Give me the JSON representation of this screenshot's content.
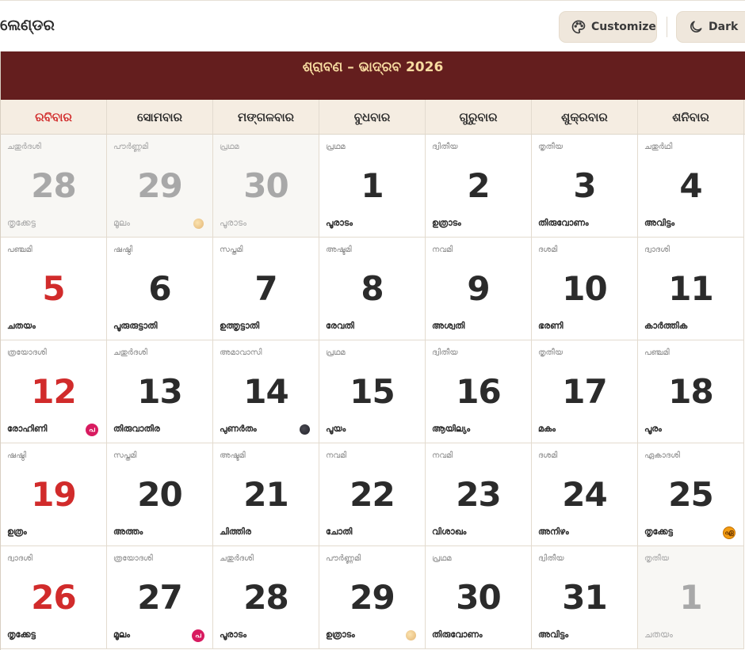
{
  "header": {
    "title": "ଲେଣ୍ଡର",
    "customize_label": "Customize",
    "dark_label": "Dark"
  },
  "banner": {
    "title": "ଶ୍ରାବଣ – ଭାଦ୍ରବ 2026"
  },
  "colors": {
    "banner_bg": "#641e1e",
    "banner_text": "#f7dba0",
    "sunday_red": "#d12b2b",
    "weekday_bg": "#f5ede2",
    "festival_pink": "#d81b60",
    "festival_orange": "#f39c12"
  },
  "weekdays": [
    "ରବିବାର",
    "ସୋମବାର",
    "ମଙ୍ଗଳବାର",
    "ବୁଧବାର",
    "ଗୁରୁବାର",
    "ଶୁକ୍ରବାର",
    "ଶନିବାର"
  ],
  "weeks": [
    [
      {
        "day": "28",
        "tithi": "ചതുർദശി",
        "star": "തൃക്കേട്ട",
        "muted": true
      },
      {
        "day": "29",
        "tithi": "പൗർണ്ണമി",
        "star": "മൂലം",
        "muted": true,
        "moon": "full"
      },
      {
        "day": "30",
        "tithi": "പ്രഥമ",
        "star": "പൂരാടം",
        "muted": true
      },
      {
        "day": "1",
        "tithi": "പ്രഥമ",
        "star": "പൂരാടം"
      },
      {
        "day": "2",
        "tithi": "ദ്വിതീയ",
        "star": "ഉത്രാടം"
      },
      {
        "day": "3",
        "tithi": "തൃതീയ",
        "star": "തിരുവോണം"
      },
      {
        "day": "4",
        "tithi": "ചതുർഥി",
        "star": "അവിട്ടം"
      }
    ],
    [
      {
        "day": "5",
        "tithi": "പഞ്ചമി",
        "star": "ചതയം"
      },
      {
        "day": "6",
        "tithi": "ഷഷ്ഠി",
        "star": "പൂരുരുട്ടാതി"
      },
      {
        "day": "7",
        "tithi": "സപ്തമി",
        "star": "ഉത്തൃട്ടാതി"
      },
      {
        "day": "8",
        "tithi": "അഷ്ടമി",
        "star": "രേവതി"
      },
      {
        "day": "9",
        "tithi": "നവമി",
        "star": "അശ്വതി"
      },
      {
        "day": "10",
        "tithi": "ദശമി",
        "star": "ഭരണി"
      },
      {
        "day": "11",
        "tithi": "ദ്വാദശി",
        "star": "കാർത്തിക"
      }
    ],
    [
      {
        "day": "12",
        "tithi": "ത്രയോദശി",
        "star": "രോഹിണി",
        "badge": "pink",
        "badge_text": "പ"
      },
      {
        "day": "13",
        "tithi": "ചതുർദശി",
        "star": "തിരുവാതിര"
      },
      {
        "day": "14",
        "tithi": "അമാവാസി",
        "star": "പുണർതം",
        "moon": "new"
      },
      {
        "day": "15",
        "tithi": "പ്രഥമ",
        "star": "പൂയം"
      },
      {
        "day": "16",
        "tithi": "ദ്വിതീയ",
        "star": "ആയില്യം"
      },
      {
        "day": "17",
        "tithi": "തൃതീയ",
        "star": "മകം"
      },
      {
        "day": "18",
        "tithi": "പഞ്ചമി",
        "star": "പൂരം"
      }
    ],
    [
      {
        "day": "19",
        "tithi": "ഷഷ്ഠി",
        "star": "ഉത്രം"
      },
      {
        "day": "20",
        "tithi": "സപ്തമി",
        "star": "അത്തം"
      },
      {
        "day": "21",
        "tithi": "അഷ്ടമി",
        "star": "ചിത്തിര"
      },
      {
        "day": "22",
        "tithi": "നവമി",
        "star": "ചോതി"
      },
      {
        "day": "23",
        "tithi": "നവമി",
        "star": "വിശാഖം"
      },
      {
        "day": "24",
        "tithi": "ദശമി",
        "star": "അനിഴം"
      },
      {
        "day": "25",
        "tithi": "ഏകാദശി",
        "star": "തൃക്കേട്ട",
        "badge": "orange",
        "badge_text": "ഏ"
      }
    ],
    [
      {
        "day": "26",
        "tithi": "ദ്വാദശി",
        "star": "തൃക്കേട്ട"
      },
      {
        "day": "27",
        "tithi": "ത്രയോദശി",
        "star": "മൂലം",
        "badge": "pink",
        "badge_text": "പ"
      },
      {
        "day": "28",
        "tithi": "ചതുർദശി",
        "star": "പൂരാടം"
      },
      {
        "day": "29",
        "tithi": "പൗർണ്ണമി",
        "star": "ഉത്രാടം",
        "moon": "full"
      },
      {
        "day": "30",
        "tithi": "പ്രഥമ",
        "star": "തിരുവോണം"
      },
      {
        "day": "31",
        "tithi": "ദ്വിതീയ",
        "star": "അവിട്ടം"
      },
      {
        "day": "1",
        "tithi": "തൃതീയ",
        "star": "ചതയം",
        "muted": true
      }
    ]
  ]
}
